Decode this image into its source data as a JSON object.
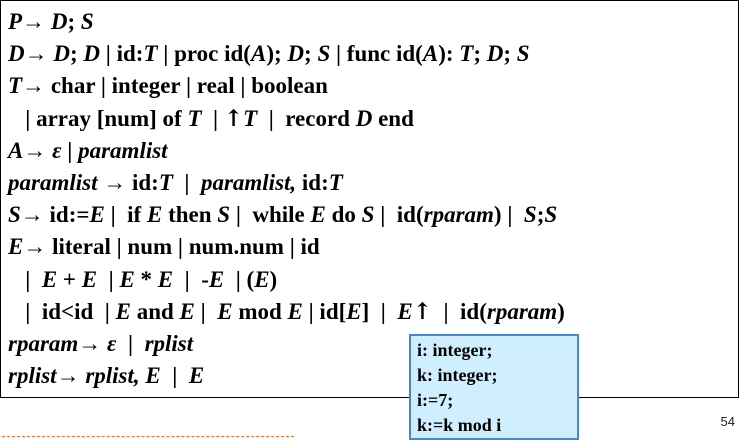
{
  "grammar": {
    "l1": {
      "a": "P→ ",
      "b": "D",
      "c": "; ",
      "d": "S"
    },
    "l2": {
      "a": "D→ ",
      "b": "D",
      "c": "; ",
      "d": "D",
      "e": " | id:",
      "f": "T",
      "g": " | proc id(",
      "h": "A",
      "i": "); ",
      "j": "D",
      "k": "; ",
      "l": "S",
      "m": " | func id(",
      "n": "A",
      "o": "): ",
      "p": "T",
      "q": "; ",
      "r": "D",
      "s": "; ",
      "t": "S"
    },
    "l3": {
      "a": "T→",
      "b": " char | integer | real | boolean"
    },
    "l4": {
      "a": "   | array [num] of ",
      "b": "T",
      "c": "  | ",
      "d": "↑",
      "e": "T",
      "f": "  |  record ",
      "g": "D",
      "h": " end"
    },
    "l5": {
      "a": "A→ ε",
      "b": " | ",
      "c": "paramlist"
    },
    "l6": {
      "a": "paramlist",
      "b": " → id:",
      "c": "T",
      "d": "  |  ",
      "e": "paramlist,",
      "f": " id:",
      "g": "T"
    },
    "l7": {
      "a": "S→",
      "b": " id:=",
      "c": "E",
      "d": " |  if ",
      "e": "E",
      "f": " then ",
      "g": "S",
      "h": " |  while ",
      "i": "E",
      "j": " do ",
      "k": "S",
      "l": " |  id(",
      "m": "rparam",
      "n": ") |  ",
      "o": "S",
      "p": ";",
      "q": "S"
    },
    "l8": {
      "a": "E→",
      "b": " literal | num | num.num | id"
    },
    "l9": {
      "a": "   |  ",
      "b": "E",
      "c": " + ",
      "d": "E",
      "e": "  | ",
      "f": "E",
      "g": " * ",
      "h": "E",
      "i": "  |  -",
      "j": "E",
      "k": "  | (",
      "l": "E",
      "m": ")"
    },
    "l10": {
      "a": "   |  id<id  | ",
      "b": "E",
      "c": " and ",
      "d": "E",
      "e": " |  ",
      "f": "E",
      "g": " mod ",
      "h": "E",
      "i": " | id[",
      "j": "E",
      "k": "]  |  ",
      "l": "E",
      "m": "↑",
      "n": "  |  id(",
      "o": "rparam",
      "p": ")"
    },
    "l11": {
      "a": "rparam→ ε",
      "b": "  |  ",
      "c": "rplist"
    },
    "l12": {
      "a": "rplist→ rplist, E",
      "b": "  |  ",
      "c": "E"
    }
  },
  "callout": {
    "lines": [
      "i: integer;",
      "k: integer;",
      "i:=7;",
      "k:=k mod i"
    ]
  },
  "page_number": "54",
  "colors": {
    "callout_bg": "#cfefff",
    "callout_border": "#4a86c8",
    "dash": "#ff6a2a"
  }
}
